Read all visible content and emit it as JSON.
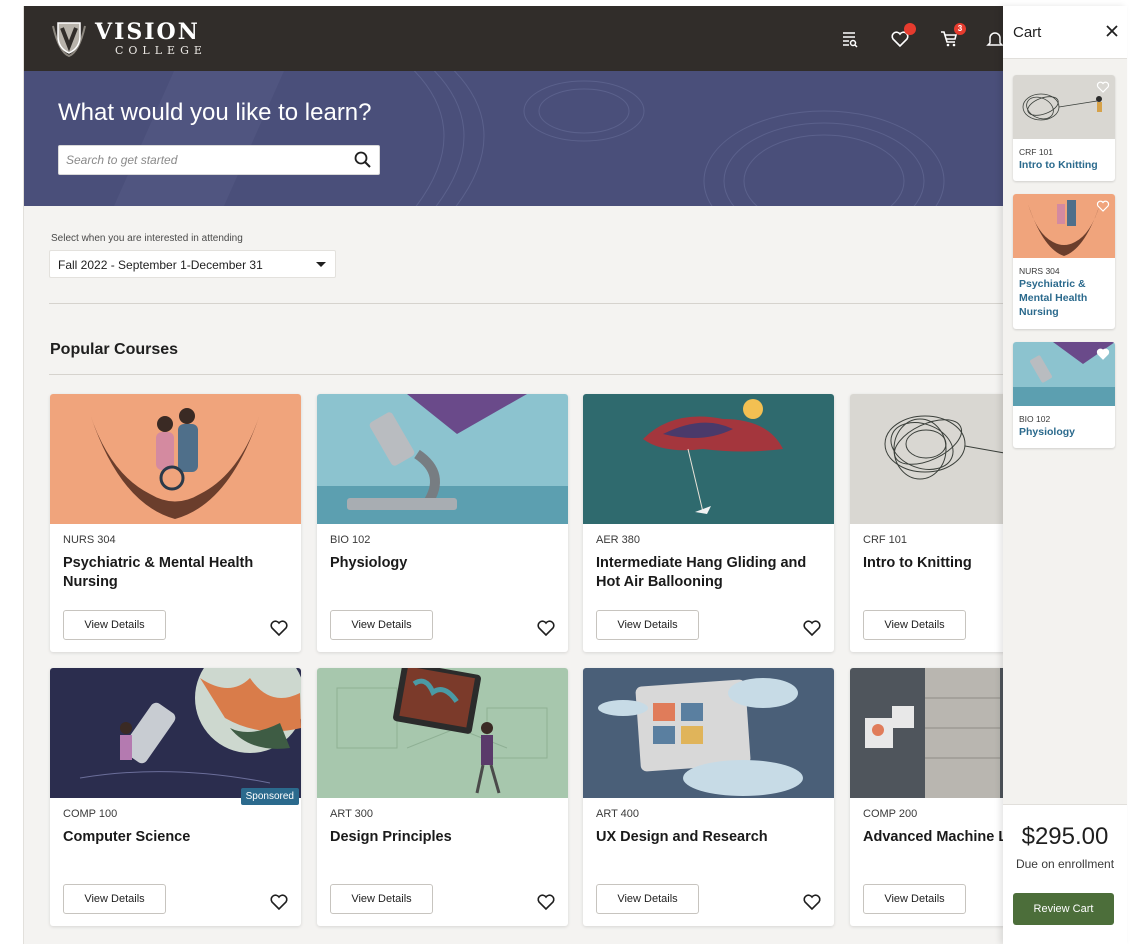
{
  "header": {
    "logo_title": "VISION",
    "logo_subtitle": "COLLEGE",
    "icons": [
      "catalog-search-icon",
      "heart-icon",
      "cart-icon",
      "bell-icon"
    ],
    "cart_badge": "3"
  },
  "hero": {
    "title": "What would you like to learn?",
    "search_placeholder": "Search to get started"
  },
  "term": {
    "label": "Select when you are interested in attending",
    "selected": "Fall 2022 - September 1-December 31"
  },
  "section_title": "Popular Courses",
  "view_details_label": "View Details",
  "courses": [
    {
      "code": "NURS 304",
      "title": "Psychiatric & Mental Health Nursing",
      "sponsored": ""
    },
    {
      "code": "BIO 102",
      "title": "Physiology",
      "sponsored": ""
    },
    {
      "code": "AER 380",
      "title": "Intermediate Hang Gliding and Hot Air Ballooning",
      "sponsored": ""
    },
    {
      "code": "CRF 101",
      "title": "Intro to Knitting",
      "sponsored": ""
    },
    {
      "code": "COMP 100",
      "title": "Computer Science",
      "sponsored": "Sponsored"
    },
    {
      "code": "ART 300",
      "title": "Design Principles",
      "sponsored": ""
    },
    {
      "code": "ART 400",
      "title": "UX Design and Research",
      "sponsored": ""
    },
    {
      "code": "COMP 200",
      "title": "Advanced Machine Learning",
      "sponsored": ""
    }
  ],
  "cart": {
    "title": "Cart",
    "items": [
      {
        "code": "CRF 101",
        "title": "Intro to Knitting"
      },
      {
        "code": "NURS 304",
        "title": "Psychiatric & Mental Health Nursing"
      },
      {
        "code": "BIO 102",
        "title": "Physiology"
      }
    ],
    "total": "$295.00",
    "due_label": "Due on enrollment",
    "review_label": "Review Cart"
  },
  "colors": {
    "header_bg": "#312d2a",
    "hero_bg": "#4a4f7a",
    "link_blue": "#2b6a8d",
    "review_green": "#4c6e3a",
    "badge_red": "#e63b2e"
  }
}
